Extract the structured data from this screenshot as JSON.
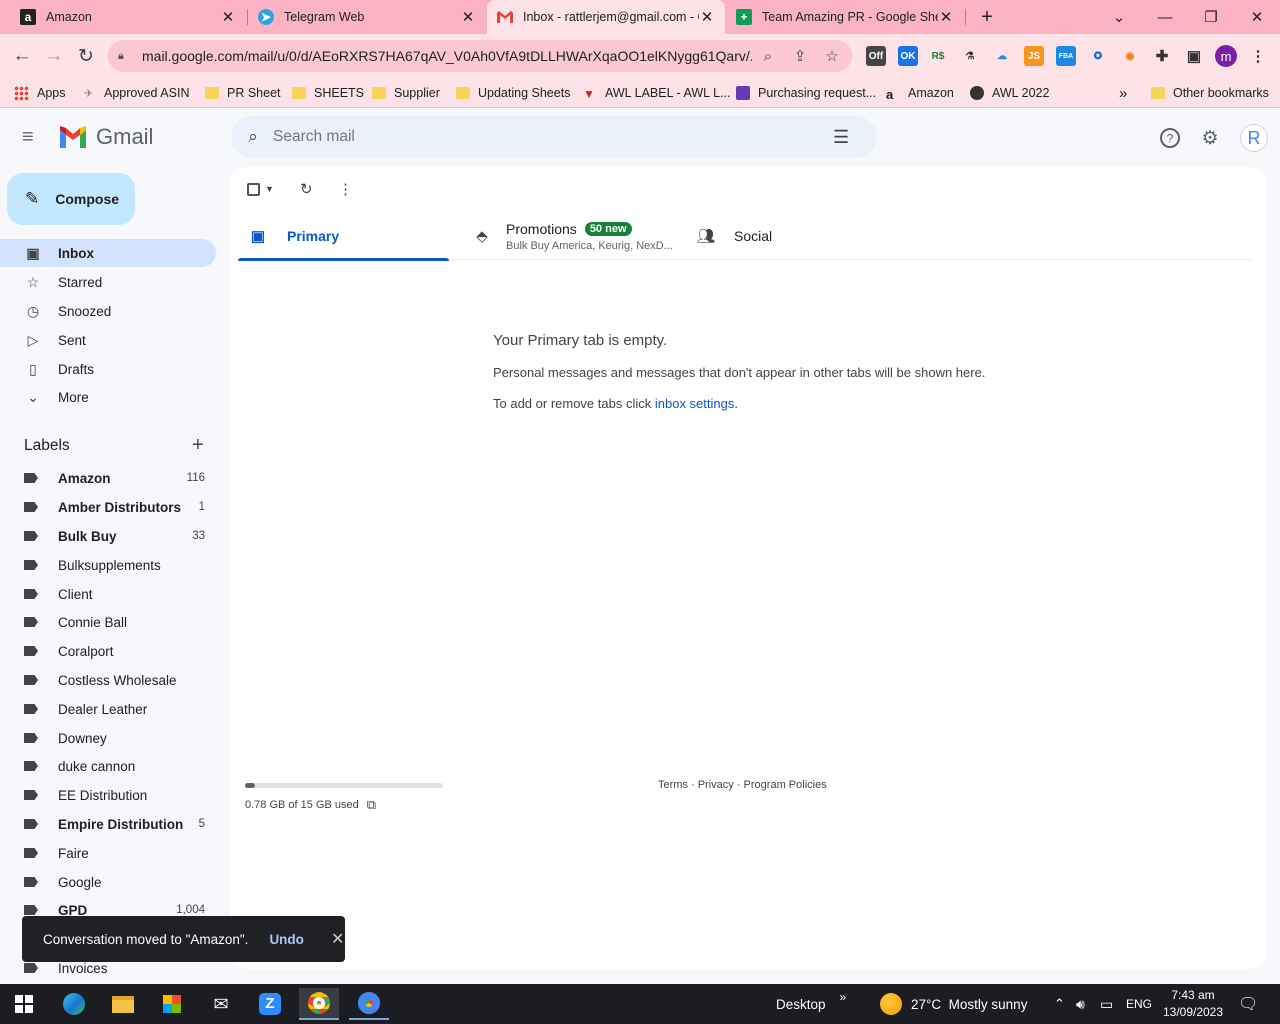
{
  "browser": {
    "tabs": [
      {
        "title": "Amazon",
        "icon": "amazon-icon"
      },
      {
        "title": "Telegram Web",
        "icon": "telegram-icon"
      },
      {
        "title": "Inbox - rattlerjem@gmail.com - G",
        "icon": "gmail-icon",
        "active": true
      },
      {
        "title": "Team Amazing PR - Google Shee",
        "icon": "sheets-icon"
      }
    ],
    "url": "mail.google.com/mail/u/0/d/AEoRXRS7HA67qAV_V0Ah0VfA9tDLLHWArXqaOO1elKNygg61Qarv/...",
    "profile_initial": "m",
    "bookmarks": [
      {
        "label": "Apps",
        "icon": "apps-grid-icon"
      },
      {
        "label": "Approved ASIN",
        "icon": "bookmark-page-icon"
      },
      {
        "label": "PR Sheet",
        "icon": "folder-icon"
      },
      {
        "label": "SHEETS",
        "icon": "folder-icon"
      },
      {
        "label": "Supplier",
        "icon": "folder-icon"
      },
      {
        "label": "Updating Sheets",
        "icon": "folder-icon"
      },
      {
        "label": "AWL LABEL - AWL L...",
        "icon": "awl-icon"
      },
      {
        "label": "Purchasing request...",
        "icon": "form-icon"
      },
      {
        "label": "Amazon",
        "icon": "amazon-icon"
      },
      {
        "label": "AWL 2022",
        "icon": "globe-icon"
      }
    ],
    "other_bookmarks": "Other bookmarks",
    "extensions": [
      "Off",
      "OK",
      "R$",
      "",
      "",
      "JS",
      "FBA",
      "",
      "",
      ""
    ]
  },
  "gmail": {
    "brand": "Gmail",
    "search_placeholder": "Search mail",
    "avatar_initial": "R",
    "compose_label": "Compose",
    "nav": [
      {
        "label": "Inbox",
        "icon": "inbox-icon",
        "active": true
      },
      {
        "label": "Starred",
        "icon": "star-icon"
      },
      {
        "label": "Snoozed",
        "icon": "clock-icon"
      },
      {
        "label": "Sent",
        "icon": "send-icon"
      },
      {
        "label": "Drafts",
        "icon": "draft-icon"
      },
      {
        "label": "More",
        "icon": "chevron-down-icon"
      }
    ],
    "labels_heading": "Labels",
    "labels": [
      {
        "name": "Amazon",
        "count": "116",
        "bold": true
      },
      {
        "name": "Amber Distributors",
        "count": "1",
        "bold": true
      },
      {
        "name": "Bulk Buy",
        "count": "33",
        "bold": true
      },
      {
        "name": "Bulksupplements",
        "count": ""
      },
      {
        "name": "Client",
        "count": ""
      },
      {
        "name": "Connie Ball",
        "count": ""
      },
      {
        "name": "Coralport",
        "count": ""
      },
      {
        "name": "Costless Wholesale",
        "count": ""
      },
      {
        "name": "Dealer Leather",
        "count": ""
      },
      {
        "name": "Downey",
        "count": ""
      },
      {
        "name": "duke cannon",
        "count": ""
      },
      {
        "name": "EE Distribution",
        "count": ""
      },
      {
        "name": "Empire Distribution",
        "count": "5",
        "bold": true
      },
      {
        "name": "Faire",
        "count": ""
      },
      {
        "name": "Google",
        "count": ""
      },
      {
        "name": "GPD",
        "count": "1,004",
        "bold": true
      },
      {
        "name": "",
        "count": ""
      },
      {
        "name": "Invoices",
        "count": ""
      }
    ],
    "category_tabs": [
      {
        "label": "Primary",
        "icon": "inbox-icon",
        "active": true
      },
      {
        "label": "Promotions",
        "icon": "tag-icon",
        "badge": "50 new",
        "subtitle": "Bulk Buy America, Keurig, NexD..."
      },
      {
        "label": "Social",
        "icon": "people-icon"
      }
    ],
    "empty": {
      "title": "Your Primary tab is empty.",
      "line1": "Personal messages and messages that don't appear in other tabs will be shown here.",
      "line2_prefix": "To add or remove tabs click ",
      "line2_link": "inbox settings",
      "line2_suffix": "."
    },
    "storage": {
      "text": "0.78 GB of 15 GB used",
      "fraction": 0.052
    },
    "footer": "Terms · Privacy · Program Policies",
    "snackbar": {
      "message": "Conversation moved to \"Amazon\".",
      "action": "Undo"
    }
  },
  "taskbar": {
    "desktop_label": "Desktop",
    "weather": "27°C  Mostly sunny",
    "lang": "ENG",
    "time": "7:43 am",
    "date": "13/09/2023"
  }
}
